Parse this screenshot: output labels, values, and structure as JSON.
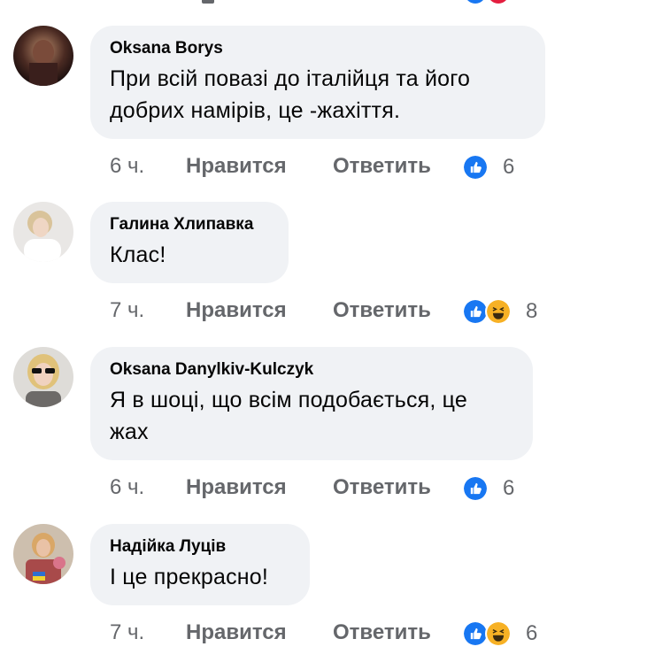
{
  "comments": [
    {
      "author": "Oksana Borys",
      "text_lines": [
        "При всій повазі до італійця та його",
        "добрих намірів,  це -жахіття."
      ],
      "time": "6 ч.",
      "like_label": "Нравится",
      "reply_label": "Ответить",
      "reactions": [
        "like"
      ],
      "reaction_count": "6"
    },
    {
      "author": "Галина Хлипавка",
      "text_lines": [
        "Клас!"
      ],
      "time": "7 ч.",
      "like_label": "Нравится",
      "reply_label": "Ответить",
      "reactions": [
        "like",
        "haha"
      ],
      "reaction_count": "8"
    },
    {
      "author": "Oksana Danylkiv-Kulczyk",
      "text_lines": [
        "Я в шоці, що всім подобається, це",
        "жах"
      ],
      "time": "6 ч.",
      "like_label": "Нравится",
      "reply_label": "Ответить",
      "reactions": [
        "like"
      ],
      "reaction_count": "6"
    },
    {
      "author": "Надійка Луців",
      "text_lines": [
        "І це прекрасно!"
      ],
      "time": "7 ч.",
      "like_label": "Нравится",
      "reply_label": "Ответить",
      "reactions": [
        "like",
        "haha"
      ],
      "reaction_count": "6"
    }
  ],
  "colors": {
    "bubble_bg": "#f0f2f5",
    "meta_text": "#65676b",
    "like_blue": "#1877f2",
    "haha_yellow": "#f7b125"
  }
}
